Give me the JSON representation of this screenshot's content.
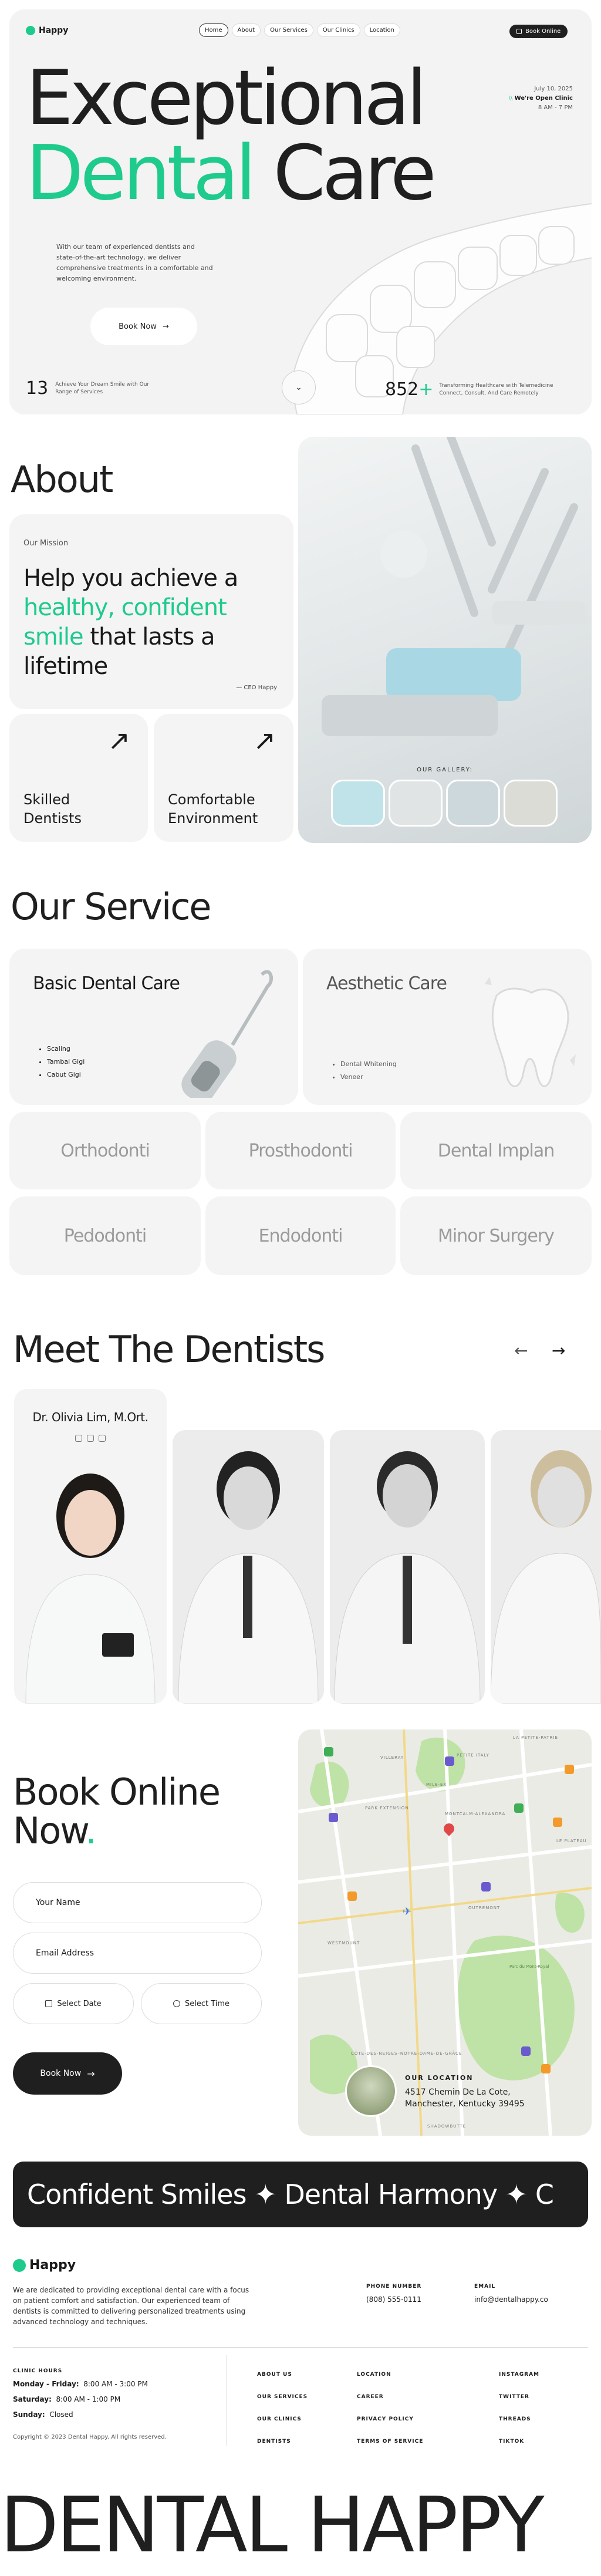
{
  "colors": {
    "accent": "#1ecb8d",
    "dark": "#1f1f1f",
    "card": "#f4f4f4"
  },
  "brand": {
    "name": "Happy"
  },
  "nav": {
    "items": [
      "Home",
      "About",
      "Our Services",
      "Our Clinics",
      "Location"
    ],
    "book": "Book Online"
  },
  "hero": {
    "line1": "Exceptional",
    "line2a": "Dental",
    "line2b": "Care",
    "date": "July 10, 2025",
    "open": "We're Open Clinic",
    "hours": "8 AM - 7 PM",
    "desc": "With our team of experienced dentists and state-of-the-art technology, we deliver comprehensive treatments in a comfortable and welcoming environment.",
    "cta": "Book Now",
    "stat1_num": "13",
    "stat1_text": "Achieve Your Dream Smile with Our Range of Services",
    "stat2_num": "852",
    "stat2_plus": "+",
    "stat2_text": "Transforming Healthcare with Telemedicine Connect, Consult, And Care Remotely"
  },
  "about": {
    "title": "About",
    "mission_label": "Our Mission",
    "m1": "Help you achieve a",
    "m2": "healthy, confident",
    "m3a": "smile",
    "m3b": " that lasts a",
    "m4": "lifetime",
    "signature": "— CEO Happy",
    "f1a": "Skilled",
    "f1b": "Dentists",
    "f2a": "Comfortable",
    "f2b": "Environment",
    "gallery": "OUR GALLERY:"
  },
  "service": {
    "title": "Our Service",
    "c1_title": "Basic Dental Care",
    "c1_items": [
      "Scaling",
      "Tambal Gigi",
      "Cabut Gigi"
    ],
    "c2_title": "Aesthetic Care",
    "c2_items": [
      "Dental Whitening",
      "Veneer"
    ],
    "grid": [
      "Orthodonti",
      "Prosthodonti",
      "Dental Implan",
      "Pedodonti",
      "Endodonti",
      "Minor Surgery"
    ]
  },
  "dentists": {
    "title": "Meet The Dentists",
    "featured": "Dr. Olivia Lim, M.Ort."
  },
  "booking": {
    "t1": "Book Online",
    "t2": "Now",
    "dot": ".",
    "name_ph": "Your Name",
    "email_ph": "Email Address",
    "date": "Select Date",
    "time": "Select Time",
    "cta": "Book Now"
  },
  "map": {
    "labels": [
      "LA PETITE-PATRIE",
      "PETITE ITALY",
      "MILE-EX",
      "PARK EXTENSION",
      "VILLERAY",
      "SAINT-MICHEL",
      "MONTCALM-ALEXANDRA",
      "LE PLATEAU",
      "AHUNTSIC",
      "OUTREMONT",
      "Parc du Mont-Royal",
      "CÔTE-DES-NEIGES–NOTRE-DAME-DE-GRÂCE",
      "WESTMOUNT",
      "SHADOWBUTTE"
    ],
    "loc_label": "OUR LOCATION",
    "addr1": "4517 Chemin De La Cote,",
    "addr2": "Manchester, Kentucky 39495"
  },
  "marquee": {
    "text": "Confident Smiles ✦ Dental Harmony ✦ C"
  },
  "footer": {
    "brand": "Happy",
    "desc": "We are dedicated to providing exceptional dental care with a focus on patient comfort and satisfaction. Our experienced team of dentists is committed to delivering personalized treatments using advanced technology and techniques.",
    "phone_label": "PHONE NUMBER",
    "phone": "(808) 555-0111",
    "email_label": "EMAIL",
    "email": "info@dentalhappy.co",
    "hours_label": "CLINIC HOURS",
    "h1_day": "Monday - Friday:",
    "h1_time": "8:00 AM - 3:00 PM",
    "h2_day": "Saturday:",
    "h2_time": "8:00 AM - 1:00 PM",
    "h3_day": "Sunday:",
    "h3_time": "Closed",
    "copyright": "Copyright © 2023 Dental Happy. All rights reserved.",
    "col1": [
      "ABOUT US",
      "OUR SERVICES",
      "OUR CLINICS",
      "DENTISTS"
    ],
    "col2": [
      "LOCATION",
      "CAREER",
      "PRIVACY POLICY",
      "TERMS OF SERVICE"
    ],
    "col3": [
      "INSTAGRAM",
      "TWITTER",
      "THREADS",
      "TIKTOK"
    ],
    "big": "DENTAL HAPPY"
  }
}
